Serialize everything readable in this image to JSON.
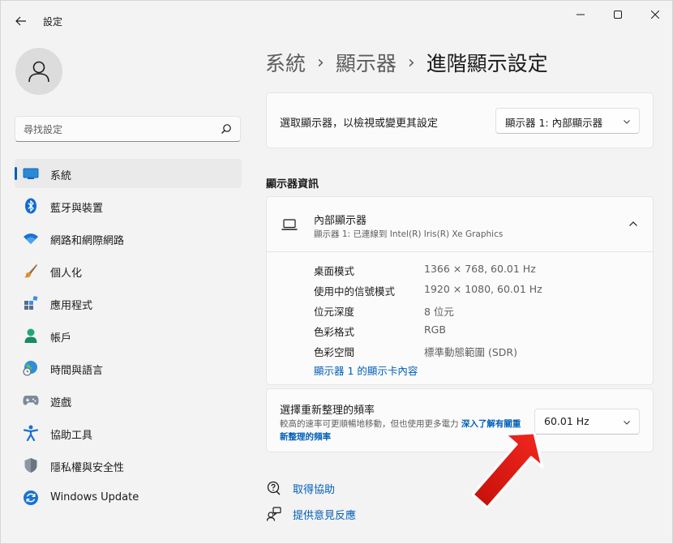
{
  "window": {
    "title": "設定"
  },
  "sidebar": {
    "search_placeholder": "尋找設定",
    "items": [
      {
        "label": "系統",
        "icon": "display-icon",
        "active": true
      },
      {
        "label": "藍牙與裝置",
        "icon": "bluetooth-icon",
        "active": false
      },
      {
        "label": "網路和網際網路",
        "icon": "wifi-icon",
        "active": false
      },
      {
        "label": "個人化",
        "icon": "brush-icon",
        "active": false
      },
      {
        "label": "應用程式",
        "icon": "apps-icon",
        "active": false
      },
      {
        "label": "帳戶",
        "icon": "person-icon",
        "active": false
      },
      {
        "label": "時間與語言",
        "icon": "globe-clock-icon",
        "active": false
      },
      {
        "label": "遊戲",
        "icon": "gamepad-icon",
        "active": false
      },
      {
        "label": "協助工具",
        "icon": "accessibility-icon",
        "active": false
      },
      {
        "label": "隱私權與安全性",
        "icon": "shield-icon",
        "active": false
      },
      {
        "label": "Windows Update",
        "icon": "update-icon",
        "active": false
      }
    ]
  },
  "breadcrumb": {
    "item1": "系統",
    "item2": "顯示器",
    "current": "進階顯示設定",
    "separator": "›"
  },
  "display_select": {
    "label": "選取顯示器，以檢視或變更其設定",
    "value": "顯示器 1: 內部顯示器"
  },
  "display_info": {
    "section_title": "顯示器資訊",
    "title": "內部顯示器",
    "subtitle": "顯示器 1: 已連線到 Intel(R) Iris(R) Xe Graphics",
    "rows": [
      {
        "key": "桌面模式",
        "value": "1366 × 768, 60.01 Hz"
      },
      {
        "key": "使用中的信號模式",
        "value": "1920 × 1080, 60.01 Hz"
      },
      {
        "key": "位元深度",
        "value": "8 位元"
      },
      {
        "key": "色彩格式",
        "value": "RGB"
      },
      {
        "key": "色彩空間",
        "value": "標準動態範圍 (SDR)"
      }
    ],
    "adapter_link": "顯示器 1 的顯示卡內容"
  },
  "refresh_rate": {
    "title": "選擇重新整理的頻率",
    "desc": "較高的速率可更順暢地移動，但也使用更多電力",
    "link": "深入了解有關重新整理的頻率",
    "value": "60.01 Hz"
  },
  "help": {
    "get_help": "取得協助",
    "feedback": "提供意見反應"
  },
  "colors": {
    "accent": "#005fb8",
    "annotation_arrow": "#e8201a"
  }
}
